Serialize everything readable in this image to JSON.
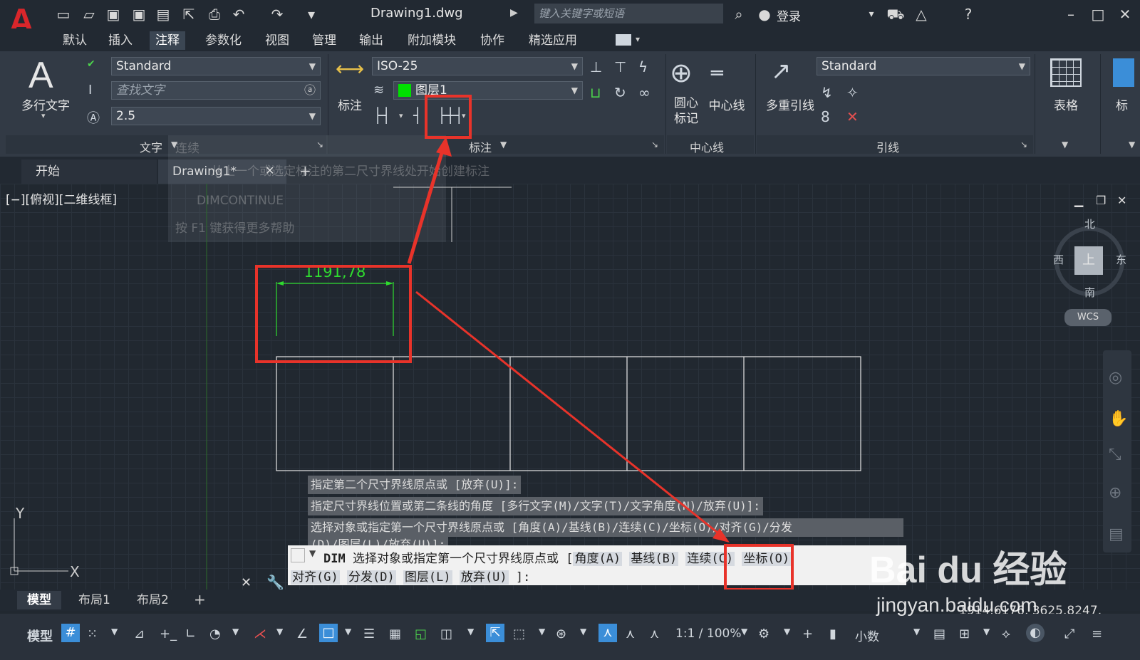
{
  "titlebar": {
    "doc_title": "Drawing1.dwg",
    "search_placeholder": "键入关键字或短语",
    "login": "登录"
  },
  "menu": [
    "默认",
    "插入",
    "注释",
    "参数化",
    "视图",
    "管理",
    "输出",
    "附加模块",
    "协作",
    "精选应用"
  ],
  "ribbon": {
    "text_panel": {
      "big_label": "多行文字",
      "style": "Standard",
      "find_placeholder": "查找文字",
      "height": "2.5",
      "title": "文字"
    },
    "dim_panel": {
      "big_label": "标注",
      "style": "ISO-25",
      "layer": "图层1",
      "title": "标注"
    },
    "center_panel": {
      "center_mark": "圆心\n标记",
      "center_line": "中心线",
      "title": "中心线"
    },
    "leader_panel": {
      "big_label": "多重引线",
      "style": "Standard",
      "title": "引线"
    },
    "table_panel": {
      "label": "表格"
    },
    "extra_panel": {
      "label": "标"
    }
  },
  "doc_tabs": [
    "开始",
    "Drawing1*"
  ],
  "viewport": {
    "label": "[−][俯视][二维线框]",
    "dimension_text": "1191,78",
    "compass": {
      "north": "北",
      "south": "南",
      "east": "东",
      "west": "西",
      "top": "上",
      "wcs": "WCS"
    },
    "tooltip": {
      "title": "连续",
      "desc": "从上一个或选定标注的第二尺寸界线处开始创建标注",
      "cmd": "DIMCONTINUE",
      "help": "按 F1 键获得更多帮助"
    }
  },
  "command_history": [
    "指定第二个尺寸界线原点或 [放弃(U)]:",
    "指定尺寸界线位置或第二条线的角度 [多行文字(M)/文字(T)/文字角度(N)/放弃(U)]:",
    "选择对象或指定第一个尺寸界线原点或 [角度(A)/基线(B)/连续(C)/坐标(O)/对齐(G)/分发",
    "(D)/图层(L)/放弃(U)]:"
  ],
  "command_input": {
    "prefix": "DIM",
    "text": "选择对象或指定第一个尺寸界线原点或 [",
    "options_line1": [
      "角度(A)",
      "基线(B)",
      "连续(C)",
      "坐标(O)"
    ],
    "options_line2": [
      "对齐(G)",
      "分发(D)",
      "图层(L)",
      "放弃(U)"
    ],
    "suffix": "]:"
  },
  "layout_tabs": [
    "模型",
    "布局1",
    "布局2"
  ],
  "status": {
    "model": "模型",
    "scale": "1:1 / 100%",
    "units": "小数",
    "coords": "1914.6176, 3625.8247, 0.0000"
  },
  "watermark": {
    "brand": "Bai du 经验",
    "url": "jingyan.baidu.com"
  },
  "colors": {
    "highlight": "#e8332a",
    "dimension": "#2fdc2f",
    "background": "#212830"
  }
}
